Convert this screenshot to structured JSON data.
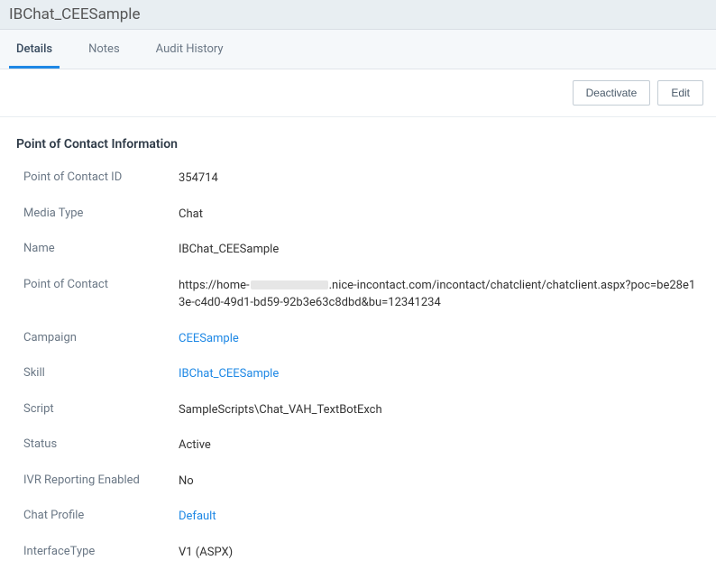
{
  "header": {
    "title": "IBChat_CEESample"
  },
  "tabs": [
    {
      "label": "Details",
      "active": true
    },
    {
      "label": "Notes",
      "active": false
    },
    {
      "label": "Audit History",
      "active": false
    }
  ],
  "actions": {
    "deactivate": "Deactivate",
    "edit": "Edit"
  },
  "section": {
    "title": "Point of Contact Information"
  },
  "fields": {
    "poc_id": {
      "label": "Point of Contact ID",
      "value": "354714"
    },
    "media_type": {
      "label": "Media Type",
      "value": "Chat"
    },
    "name": {
      "label": "Name",
      "value": "IBChat_CEESample"
    },
    "poc": {
      "label": "Point of Contact",
      "value_pre": "https://home-",
      "value_post": ".nice-incontact.com/incontact/chatclient/chatclient.aspx?poc=be28e13e-c4d0-49d1-bd59-92b3e63c8dbd&bu=12341234"
    },
    "campaign": {
      "label": "Campaign",
      "value": "CEESample"
    },
    "skill": {
      "label": "Skill",
      "value": "IBChat_CEESample"
    },
    "script": {
      "label": "Script",
      "value": "SampleScripts\\Chat_VAH_TextBotExch"
    },
    "status": {
      "label": "Status",
      "value": "Active"
    },
    "ivr": {
      "label": "IVR Reporting Enabled",
      "value": "No"
    },
    "chat_profile": {
      "label": "Chat Profile",
      "value": "Default"
    },
    "interface_type": {
      "label": "InterfaceType",
      "value": "V1 (ASPX)"
    }
  }
}
